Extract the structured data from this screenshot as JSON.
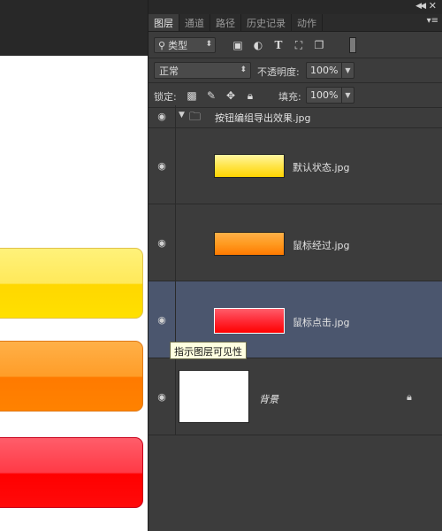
{
  "panel": {
    "tabs": [
      "图层",
      "通道",
      "路径",
      "历史记录",
      "动作"
    ],
    "active_tab": 0,
    "filter": {
      "label": "类型"
    },
    "blend_mode": "正常",
    "opacity_label": "不透明度:",
    "opacity_value": "100%",
    "lock_label": "锁定:",
    "fill_label": "填充:",
    "fill_value": "100%",
    "layers": [
      {
        "name": "按钮编组导出效果.jpg",
        "type": "group",
        "visible": true,
        "expanded": true
      },
      {
        "name": "默认状态.jpg",
        "thumb_color": "#ffe54a",
        "visible": true
      },
      {
        "name": "鼠标经过.jpg",
        "thumb_color": "#ff8a10",
        "visible": true
      },
      {
        "name": "鼠标点击.jpg",
        "thumb_color": "#ff1a1a",
        "visible": true,
        "selected": true
      },
      {
        "name": "背景",
        "thumb_color": "#ffffff",
        "visible": true,
        "locked": true
      }
    ],
    "tooltip": "指示图层可见性"
  },
  "colors": {
    "panel_bg": "#3c3c3c",
    "selected_layer": "#4b566e",
    "yellow": "#ffe000",
    "orange": "#ff8200",
    "red": "#ff0000"
  }
}
